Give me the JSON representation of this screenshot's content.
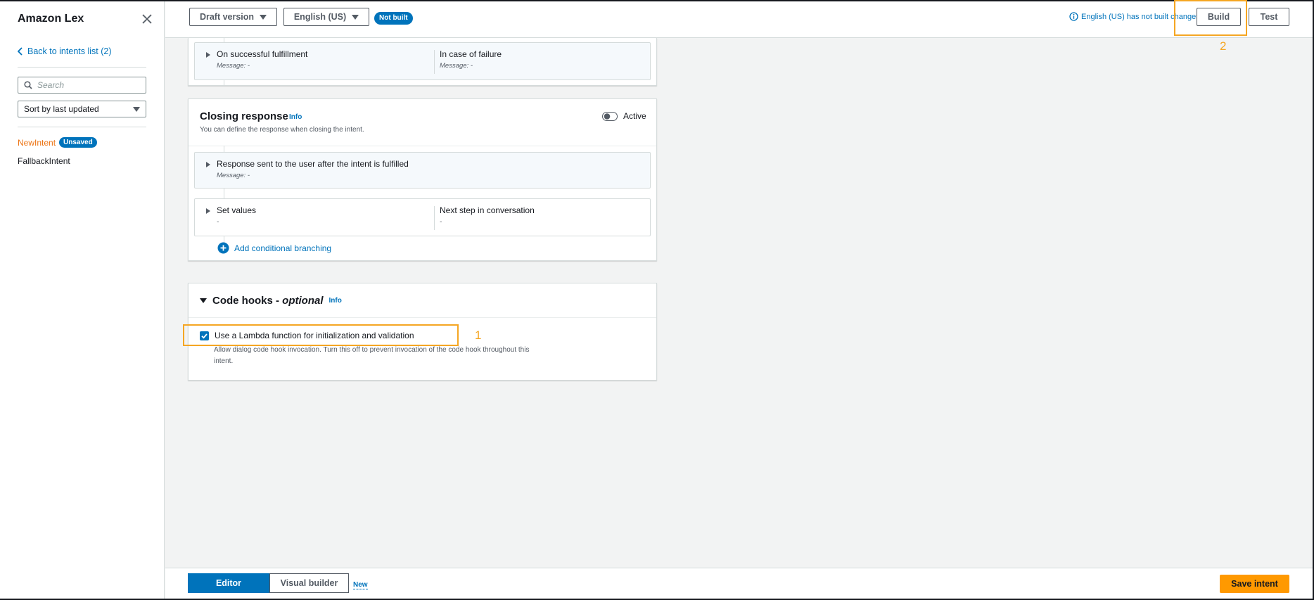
{
  "sidebar": {
    "title": "Amazon Lex",
    "back_label": "Back to intents list (2)",
    "search_placeholder": "Search",
    "sort_label": "Sort by last updated",
    "intents": [
      {
        "name": "NewIntent",
        "badge": "Unsaved"
      },
      {
        "name": "FallbackIntent"
      }
    ]
  },
  "topbar": {
    "version_label": "Draft version",
    "language_label": "English (US)",
    "status_badge": "Not built",
    "notice": "English (US) has not built changes.",
    "build_label": "Build",
    "test_label": "Test"
  },
  "fulfillment": {
    "success_label": "On successful fulfillment",
    "success_msg": "Message: -",
    "failure_label": "In case of failure",
    "failure_msg": "Message: -"
  },
  "closing": {
    "title": "Closing response",
    "info": "Info",
    "desc": "You can define the response when closing the intent.",
    "toggle_label": "Active",
    "response_label": "Response sent to the user after the intent is fulfilled",
    "response_msg": "Message: -",
    "set_values_label": "Set values",
    "set_values_value": "-",
    "next_step_label": "Next step in conversation",
    "next_step_value": "-",
    "add_branch_label": "Add conditional branching"
  },
  "code_hooks": {
    "title": "Code hooks - ",
    "title_em": "optional",
    "info": "Info",
    "checkbox_label": "Use a Lambda function for initialization and validation",
    "checkbox_checked": true,
    "help": "Allow dialog code hook invocation. Turn this off to prevent invocation of the code hook throughout this intent."
  },
  "bottom": {
    "editor_label": "Editor",
    "visual_label": "Visual builder",
    "new_label": "New",
    "save_label": "Save intent"
  },
  "annotations": {
    "one": "1",
    "two": "2"
  },
  "colors": {
    "accent": "#0073bb",
    "orange": "#ec7211",
    "save": "#ff9900",
    "highlight": "#f5a623"
  }
}
